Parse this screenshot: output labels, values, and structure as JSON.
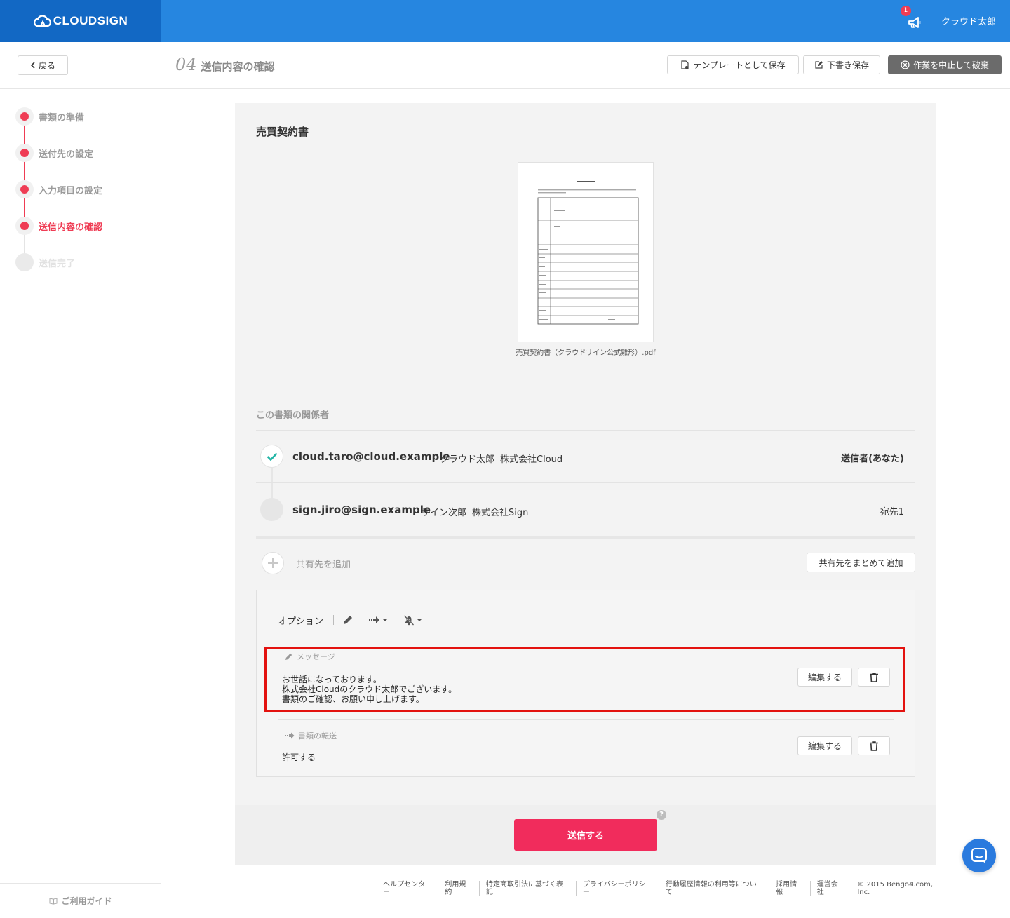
{
  "header": {
    "brand": "CLOUDSIGN",
    "notification_count": "1",
    "user_name": "クラウド太郎"
  },
  "subheader": {
    "back_label": "戻る",
    "step_number": "04",
    "step_title": "送信内容の確認",
    "save_template_label": "テンプレートとして保存",
    "save_draft_label": "下書き保存",
    "discard_label": "作業を中止して破棄"
  },
  "sidebar": {
    "steps": [
      {
        "label": "書類の準備",
        "state": "done"
      },
      {
        "label": "送付先の設定",
        "state": "done"
      },
      {
        "label": "入力項目の設定",
        "state": "done"
      },
      {
        "label": "送信内容の確認",
        "state": "current"
      },
      {
        "label": "送信完了",
        "state": "pending"
      }
    ],
    "guide_label": "ご利用ガイド"
  },
  "document": {
    "title": "売買契約書",
    "file_name": "売買契約書（クラウドサイン公式雛形）.pdf"
  },
  "parties": {
    "section_title": "この書類の関係者",
    "list": [
      {
        "email": "cloud.taro@cloud.example",
        "name": "クラウド太郎",
        "company": "株式会社Cloud",
        "role": "送信者(あなた)",
        "status": "confirmed"
      },
      {
        "email": "sign.jiro@sign.example",
        "name": "サイン次郎",
        "company": "株式会社Sign",
        "role": "宛先1",
        "status": "pending"
      }
    ],
    "add_share_label": "共有先を追加",
    "bulk_share_label": "共有先をまとめて追加"
  },
  "options": {
    "title": "オプション",
    "message": {
      "label": "メッセージ",
      "body": "お世話になっております。\n株式会社Cloudのクラウド太郎でございます。\n書類のご確認、お願い申し上げます。",
      "edit_label": "編集する"
    },
    "forwarding": {
      "label": "書類の転送",
      "value": "許可する",
      "edit_label": "編集する"
    }
  },
  "send": {
    "label": "送信する",
    "help": "?"
  },
  "footer": {
    "links": [
      "ヘルプセンター",
      "利用規約",
      "特定商取引法に基づく表記",
      "プライバシーポリシー",
      "行動履歴情報の利用等について",
      "採用情報",
      "運営会社"
    ],
    "copyright": "© 2015 Bengo4.com, Inc."
  },
  "colors": {
    "brand_blue": "#2686e0",
    "brand_dark_blue": "#1268c4",
    "accent_red": "#ef3c54",
    "send_button": "#f12c5c",
    "highlight_border": "#e3120f"
  }
}
